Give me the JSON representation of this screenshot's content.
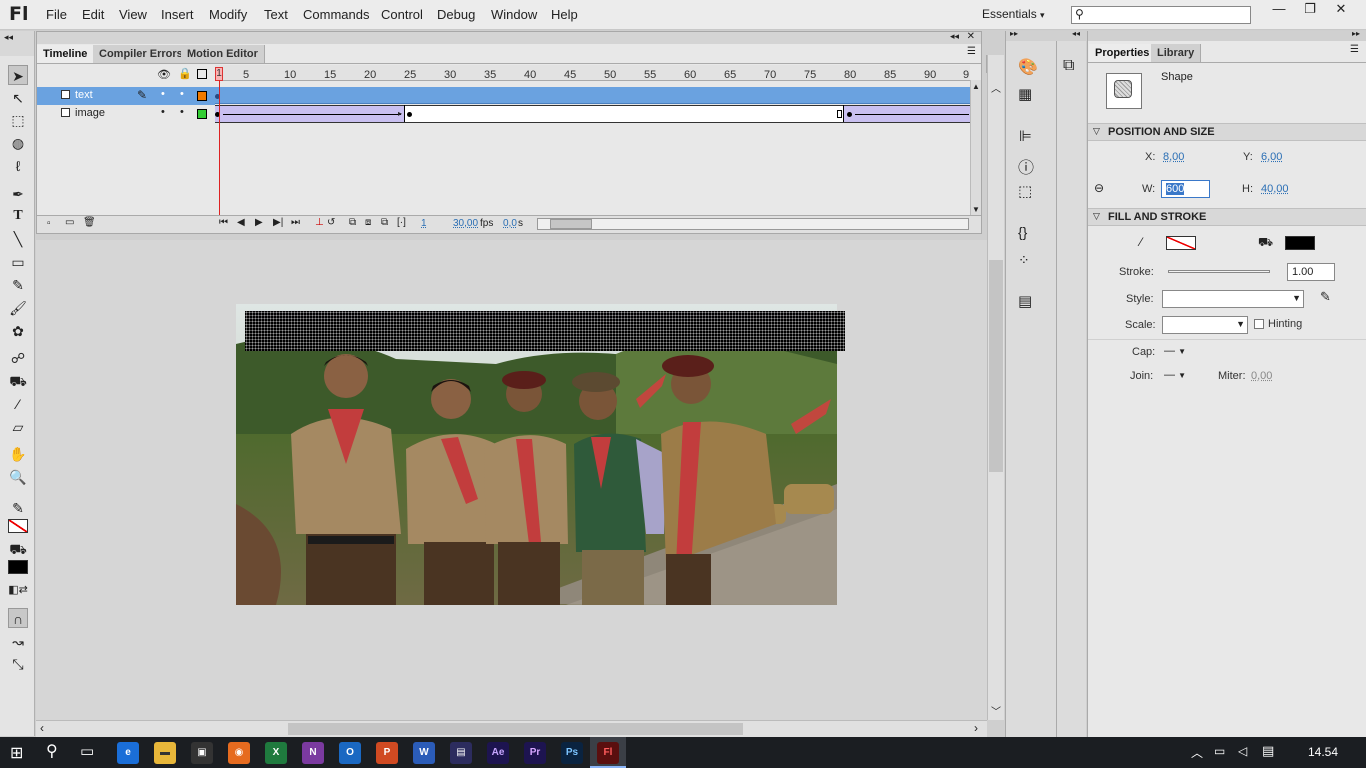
{
  "app": {
    "logo": "Fl"
  },
  "menu": [
    "File",
    "Edit",
    "View",
    "Insert",
    "Modify",
    "Text",
    "Commands",
    "Control",
    "Debug",
    "Window",
    "Help"
  ],
  "workspace": {
    "label": "Essentials"
  },
  "timeline": {
    "tabs": [
      "Timeline",
      "Compiler Errors",
      "Motion Editor"
    ],
    "ruler": [
      "1",
      "5",
      "10",
      "15",
      "20",
      "25",
      "30",
      "35",
      "40",
      "45",
      "50",
      "55",
      "60",
      "65",
      "70",
      "75",
      "80",
      "85",
      "90",
      "9"
    ],
    "layers": [
      {
        "name": "text"
      },
      {
        "name": "image"
      }
    ],
    "current_frame": "1",
    "fps": "30,00",
    "fps_unit": "fps",
    "time": "0,0",
    "time_unit": "s"
  },
  "properties": {
    "tabs": [
      "Properties",
      "Library"
    ],
    "object_type": "Shape",
    "sections": {
      "position": "POSITION AND SIZE",
      "fill": "FILL AND STROKE"
    },
    "x_label": "X:",
    "x": "8,00",
    "y_label": "Y:",
    "y": "6,00",
    "w_label": "W:",
    "w": "600",
    "h_label": "H:",
    "h": "40,00",
    "stroke_label": "Stroke:",
    "stroke": "1.00",
    "style_label": "Style:",
    "scale_label": "Scale:",
    "hinting": "Hinting",
    "cap_label": "Cap:",
    "join_label": "Join:",
    "miter_label": "Miter:",
    "miter": "0,00",
    "fill_color": "#000000",
    "stroke_color": "none"
  },
  "taskbar": {
    "time": "14.54"
  }
}
